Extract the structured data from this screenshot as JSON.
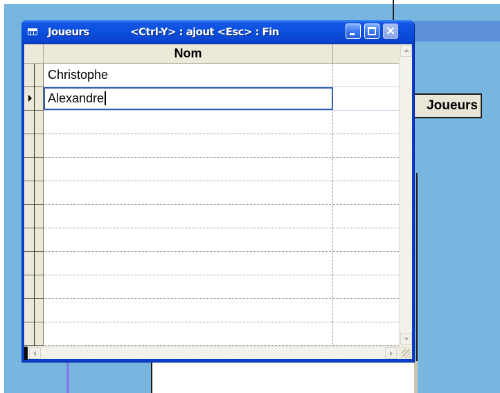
{
  "window": {
    "title": "Joueurs",
    "shortcut_hint": "<Ctrl-Y> : ajout   <Esc> : Fin",
    "icon": "datasheet-icon",
    "controls": {
      "minimize_icon": "minimize-icon",
      "maximize_icon": "maximize-icon",
      "close_icon": "close-icon",
      "close_glyph": "×"
    }
  },
  "datasheet": {
    "columns": [
      "Nom",
      ""
    ],
    "rows": [
      {
        "nom": "Christophe"
      },
      {
        "nom": "Alexandre"
      }
    ],
    "current_row_index": 1,
    "empty_row_count": 10
  },
  "background": {
    "button_label": "Joueurs"
  },
  "colors": {
    "title_bar": "#0a4fdc",
    "desktop_blue": "#78b6e0",
    "selection_border": "#2f5faf"
  }
}
